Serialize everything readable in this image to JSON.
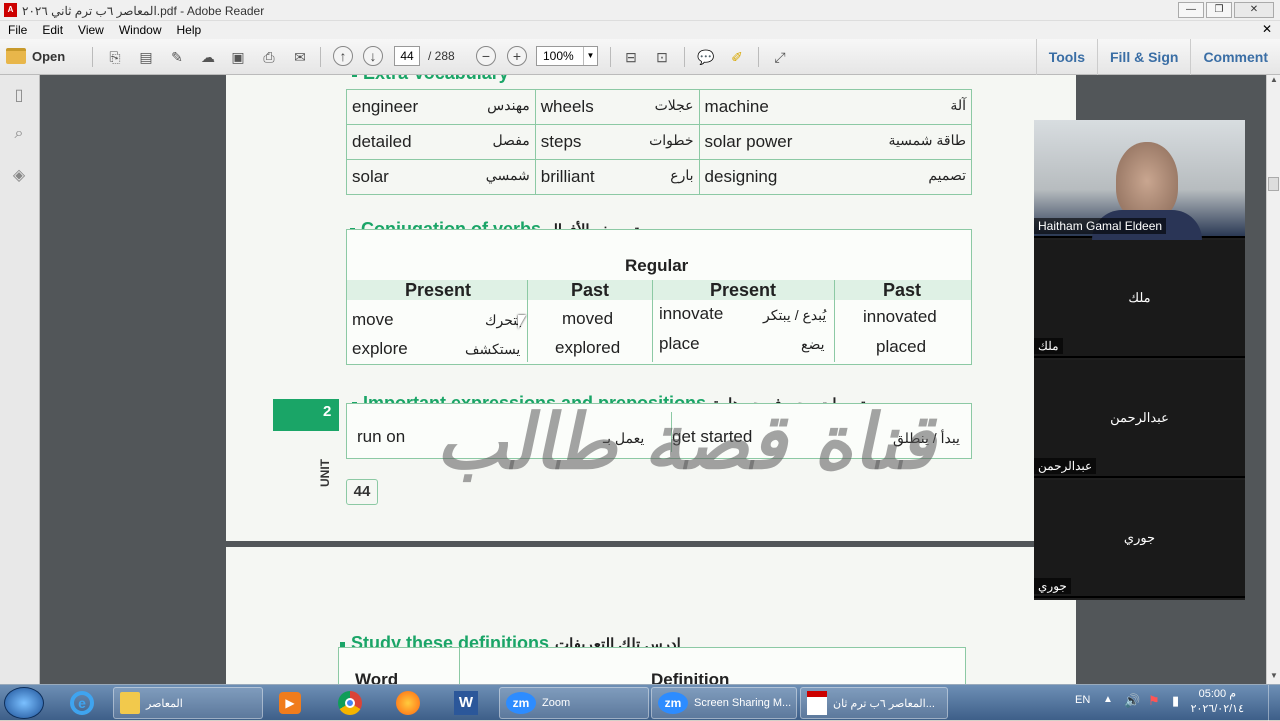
{
  "window": {
    "title": "المعاصر ٦ب ترم ثاني ٢٠٢٦.pdf - Adobe Reader"
  },
  "menu": [
    "File",
    "Edit",
    "View",
    "Window",
    "Help"
  ],
  "toolbar": {
    "open": "Open",
    "page_current": "44",
    "page_total": "/ 288",
    "zoom": "100%"
  },
  "right_tools": [
    "Tools",
    "Fill & Sign",
    "Comment"
  ],
  "page": {
    "vocab_heading": "Extra Vocabulary",
    "vocab": [
      [
        {
          "en": "engineer",
          "ar": "مهندس"
        },
        {
          "en": "wheels",
          "ar": "عجلات"
        },
        {
          "en": "machine",
          "ar": "آلة"
        }
      ],
      [
        {
          "en": "detailed",
          "ar": "مفصل"
        },
        {
          "en": "steps",
          "ar": "خطوات"
        },
        {
          "en": "solar power",
          "ar": "طاقة شمسية"
        }
      ],
      [
        {
          "en": "solar",
          "ar": "شمسي"
        },
        {
          "en": "brilliant",
          "ar": "بارع"
        },
        {
          "en": "designing",
          "ar": "تصميم"
        }
      ]
    ],
    "conj_heading": "Conjugation of verbs",
    "conj_heading_ar": "تصريف الأفعال",
    "regular": "Regular",
    "col_present": "Present",
    "col_past": "Past",
    "verbs_left": [
      {
        "present": "move",
        "ar": "يتحرك",
        "past": "moved"
      },
      {
        "present": "explore",
        "ar": "يستكشف",
        "past": "explored"
      }
    ],
    "verbs_right": [
      {
        "present": "innovate",
        "ar": "يُبدع / يبتكر",
        "past": "innovated"
      },
      {
        "present": "place",
        "ar": "يضع",
        "past": "placed"
      }
    ],
    "expr_heading": "Important expressions and prepositions",
    "expr_heading_ar": "تعبيرات وحروف جر هامة",
    "expr": [
      {
        "en": "run on",
        "ar": "يعمل بـ"
      },
      {
        "en": "get started",
        "ar": "يبدأ / ينطلق"
      }
    ],
    "unit_label": "UNIT",
    "unit_num": "2",
    "page_num": "44",
    "watermark": "قناة قصة طالب",
    "study_heading": "Study these definitions",
    "study_heading_ar": "ادرس تلك التعريفات",
    "study_col_word": "Word",
    "study_col_def": "Definition"
  },
  "participants": [
    {
      "name": "Haitham Gamal Eldeen",
      "center": ""
    },
    {
      "name": "ملك",
      "center": "ملك"
    },
    {
      "name": "عبدالرحمن",
      "center": "عبدالرحمن"
    },
    {
      "name": "جوري",
      "center": "جوري"
    }
  ],
  "taskbar": {
    "folder_label": "المعاصر",
    "zoom_label": "Zoom",
    "screen_label": "Screen Sharing M...",
    "pdf_label": "المعاصر ٦ب ترم ثان...",
    "lang": "EN",
    "time": "05:00 م",
    "date": "٢٠٢٦/٠٢/١٤"
  }
}
